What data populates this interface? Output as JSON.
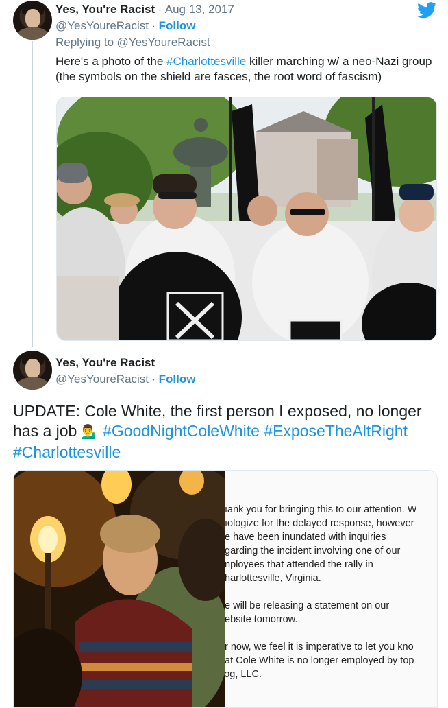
{
  "tweet1": {
    "author_name": "Yes, You're Racist",
    "date_separator": "·",
    "date": "Aug 13, 2017",
    "handle": "@YesYoureRacist",
    "handle_separator": "·",
    "follow_label": "Follow",
    "reply_prefix": "Replying to",
    "reply_to": "@YesYoureRacist",
    "text_before": "Here's a photo of the ",
    "hashtag": "#Charlottesville",
    "text_after": " killer marching w/ a neo-Nazi group (the symbols on the shield are fasces, the root word of fascism)"
  },
  "tweet2": {
    "author_name": "Yes, You're Racist",
    "handle": "@YesYoureRacist",
    "handle_separator": "·",
    "follow_label": "Follow",
    "text_line1": "UPDATE: Cole White, the first person I exposed, no longer",
    "text_line2": "has a job",
    "emoji": "💁‍♂️",
    "hashtag1": "#GoodNightColeWhite",
    "hashtag2": "#ExposeTheAltRight",
    "hashtag3": "#Charlottesville",
    "document_lines": [
      "ıank you for bringing this to our attention. W",
      "ıologize for the delayed response, however",
      "e have been inundated with inquiries",
      "garding the incident involving one of our",
      "nployees that attended the rally in",
      "harlottesville, Virginia.",
      "",
      "e will be releasing a statement on our",
      "ebsite tomorrow.",
      "",
      "r now, we feel it is imperative to let you kno",
      "at Cole White is no longer employed by top",
      "ɔg, LLC."
    ]
  },
  "icons": {
    "twitter": "twitter-bird-icon"
  },
  "colors": {
    "link_blue": "#1b95e0",
    "muted_gray": "#657786",
    "thread_line": "#ccd6dd"
  }
}
